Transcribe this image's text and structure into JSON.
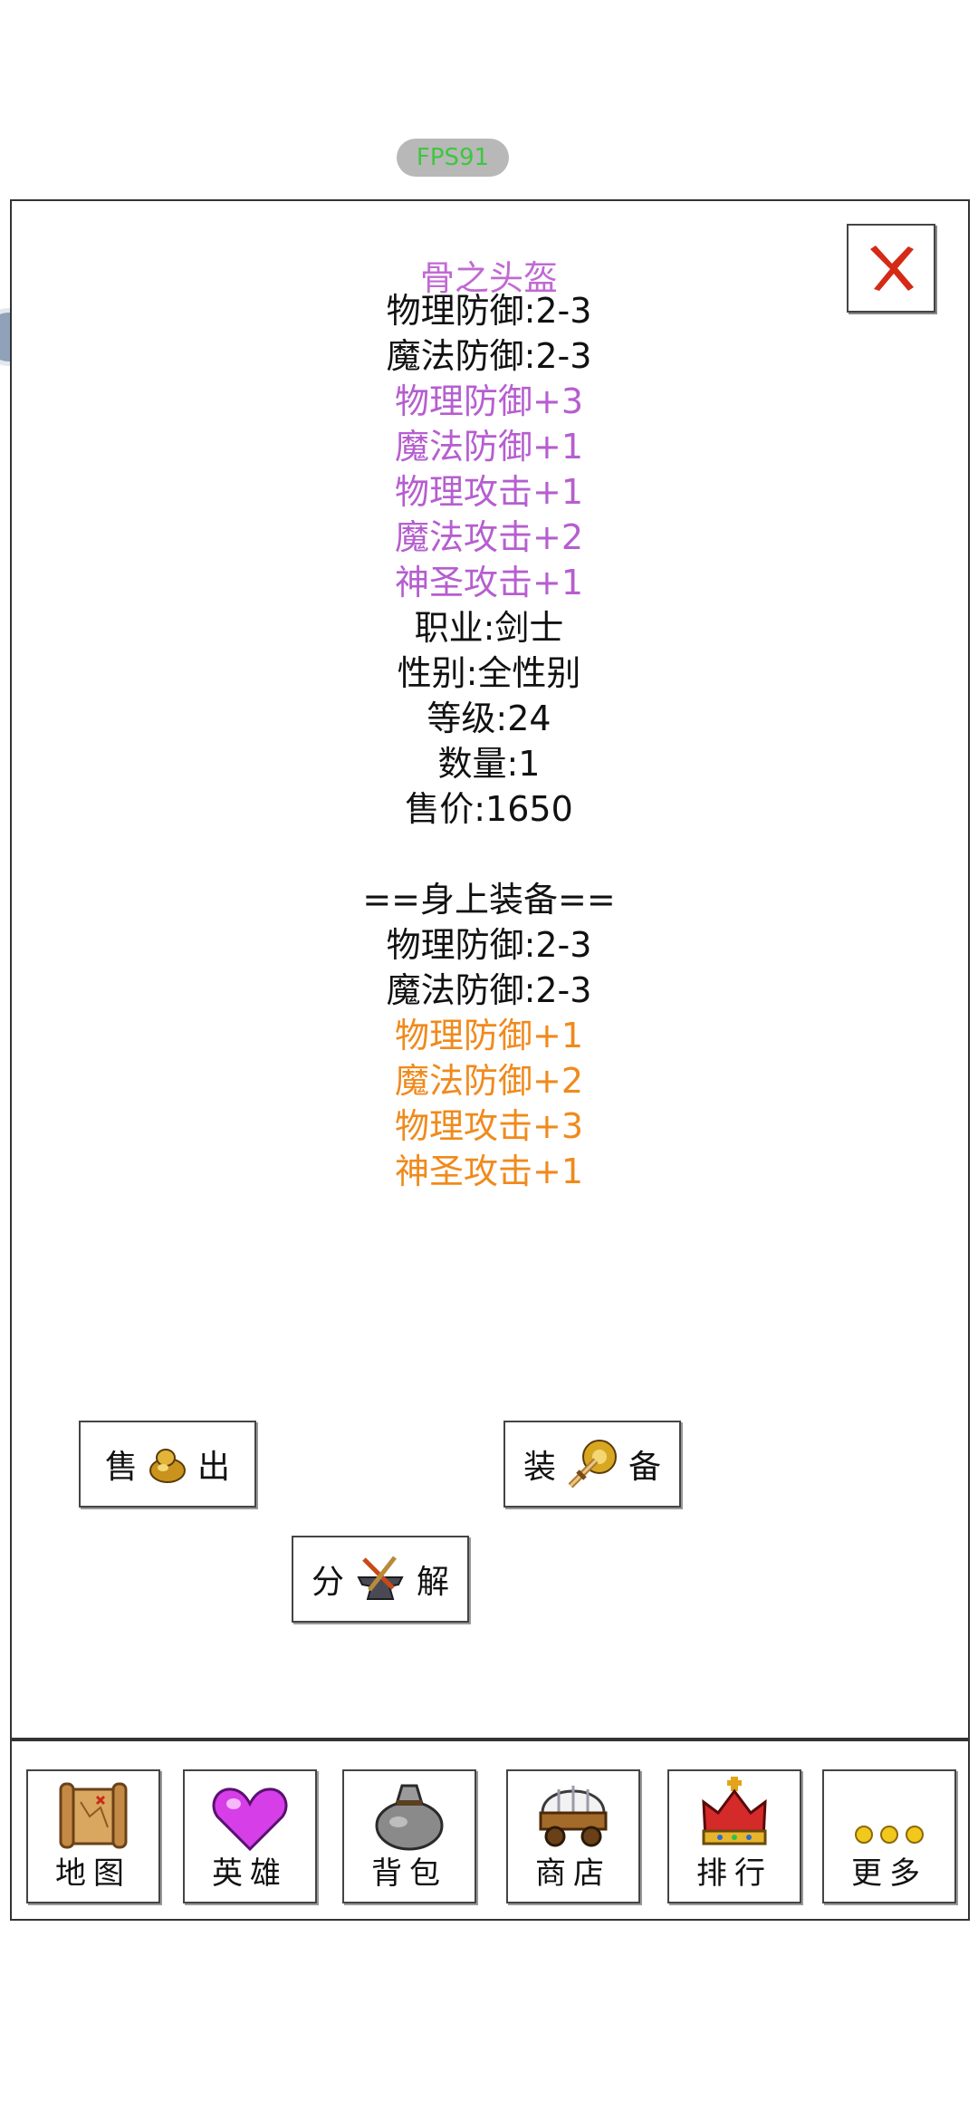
{
  "fps_label": "FPS91",
  "item": {
    "name": "骨之头盔",
    "base_stats": [
      "物理防御:2-3",
      "魔法防御:2-3"
    ],
    "bonus_stats": [
      "物理防御+3",
      "魔法防御+1",
      "物理攻击+1",
      "魔法攻击+2",
      "神圣攻击+1"
    ],
    "info": [
      "职业:剑士",
      "性别:全性别",
      "等级:24",
      "数量:1",
      "售价:1650"
    ]
  },
  "equipped": {
    "header": "==身上装备==",
    "base_stats": [
      "物理防御:2-3",
      "魔法防御:2-3"
    ],
    "bonus_stats": [
      "物理防御+1",
      "魔法防御+2",
      "物理攻击+3",
      "神圣攻击+1"
    ]
  },
  "actions": {
    "sell": {
      "left": "售",
      "right": "出",
      "icon": "gold-sack-icon"
    },
    "equip": {
      "left": "装",
      "right": "备",
      "icon": "sword-shield-icon"
    },
    "decompose": {
      "left": "分",
      "right": "解",
      "icon": "anvil-hammer-icon"
    }
  },
  "nav": [
    {
      "label": "地图",
      "icon": "map-icon"
    },
    {
      "label": "英雄",
      "icon": "heart-icon"
    },
    {
      "label": "背包",
      "icon": "bag-icon"
    },
    {
      "label": "商店",
      "icon": "wagon-icon"
    },
    {
      "label": "排行",
      "icon": "crown-icon"
    },
    {
      "label": "更多",
      "icon": "more-dots-icon"
    }
  ],
  "colors": {
    "rare": "#b65ed0",
    "epic": "#f08a1c",
    "fps_text": "#3fc63f"
  }
}
